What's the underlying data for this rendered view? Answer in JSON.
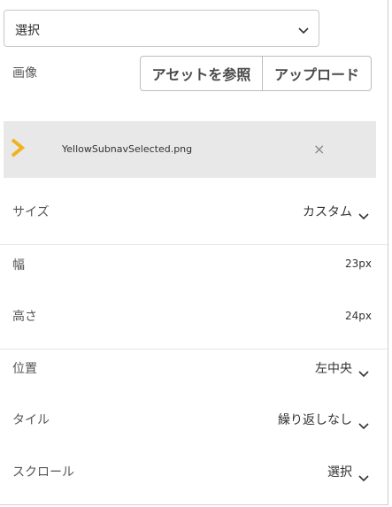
{
  "top_select": {
    "label": "選択"
  },
  "image": {
    "label": "画像",
    "browse_label": "アセットを参照",
    "upload_label": "アップロード"
  },
  "asset": {
    "filename": "YellowSubnavSelected.png",
    "close_glyph": "×",
    "arrow_color": "#f0b21e"
  },
  "size": {
    "label": "サイズ",
    "value": "カスタム"
  },
  "width": {
    "label": "幅",
    "value": "23px"
  },
  "height": {
    "label": "高さ",
    "value": "24px"
  },
  "position": {
    "label": "位置",
    "value": "左中央"
  },
  "tile": {
    "label": "タイル",
    "value": "繰り返しなし"
  },
  "scroll": {
    "label": "スクロール",
    "value": "選択"
  }
}
